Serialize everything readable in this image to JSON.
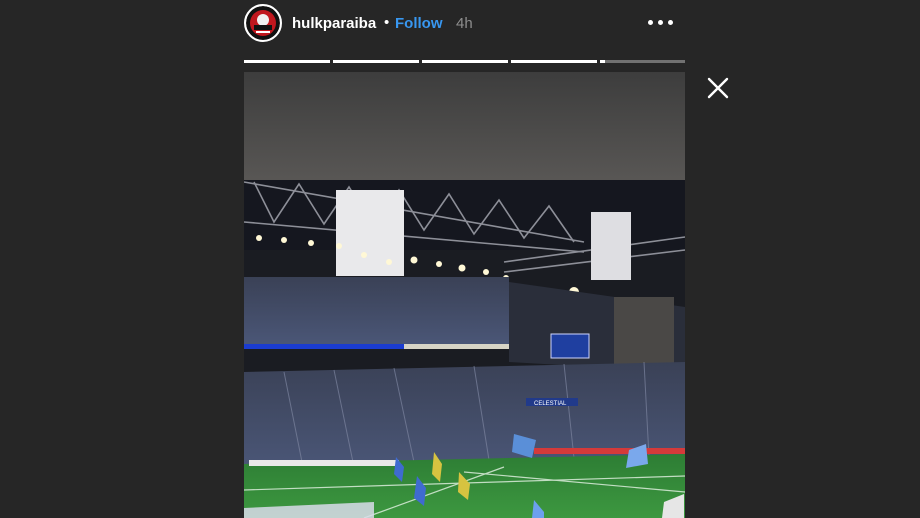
{
  "story": {
    "username": "hulkparaiba",
    "separator": "•",
    "follow_label": "Follow",
    "time_ago": "4h",
    "progress": [
      1,
      1,
      1,
      1,
      0.06
    ],
    "media": {
      "board_text": "CELESTIAL"
    }
  },
  "icons": {
    "more": "more-options-icon",
    "close": "close-icon",
    "avatar": "profile-avatar"
  },
  "colors": {
    "background": "#262626",
    "follow": "#3897f0",
    "text": "#ffffff",
    "time": "#8e8e8e"
  }
}
